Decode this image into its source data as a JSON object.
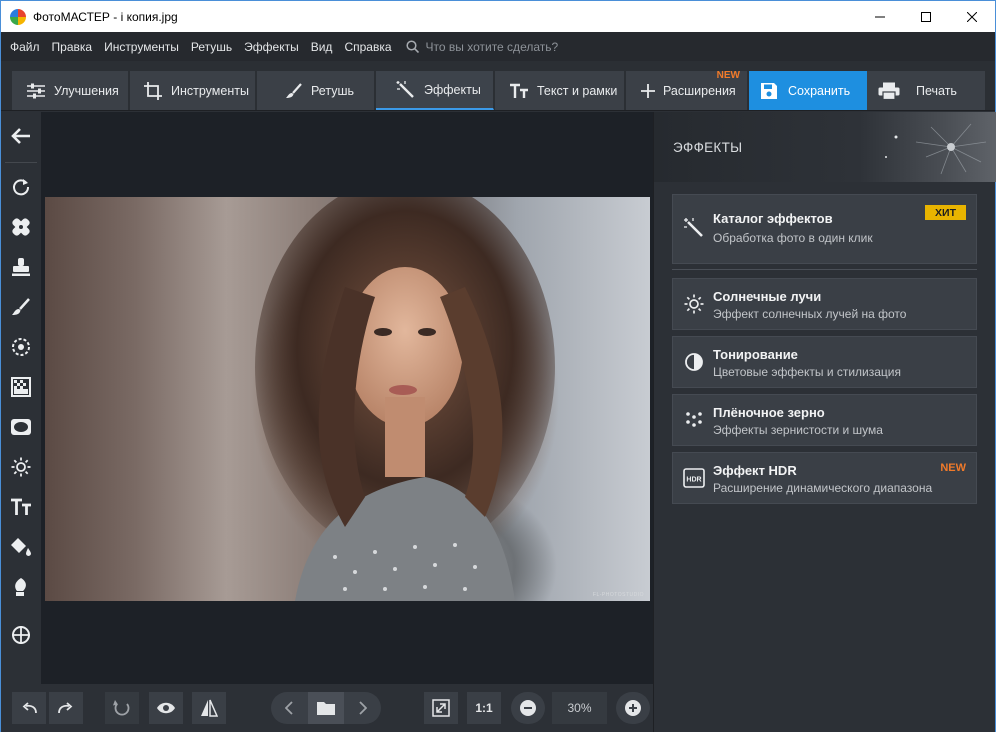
{
  "window": {
    "title": "ФотоМАСТЕР - i копия.jpg",
    "controls": [
      "minimize-icon",
      "maximize-icon",
      "close-icon"
    ]
  },
  "menu": {
    "items": [
      "Файл",
      "Правка",
      "Инструменты",
      "Ретушь",
      "Эффекты",
      "Вид",
      "Справка"
    ],
    "search_placeholder": "Что вы хотите сделать?"
  },
  "toolbar": {
    "tabs": [
      {
        "label": "Улучшения",
        "icon": "sliders-icon"
      },
      {
        "label": "Инструменты",
        "icon": "crop-icon"
      },
      {
        "label": "Ретушь",
        "icon": "brush-icon"
      },
      {
        "label": "Эффекты",
        "icon": "magic-wand-icon",
        "active": true
      },
      {
        "label": "Текст и рамки",
        "icon": "text-icon"
      },
      {
        "label": "Расширения",
        "icon": "plus-icon",
        "badge": "NEW"
      }
    ],
    "save_label": "Сохранить",
    "print_label": "Печать"
  },
  "left_tools": [
    "back-arrow-icon",
    "rotate-icon",
    "patch-icon",
    "stamp-icon",
    "brush-icon",
    "radial-icon",
    "gradient-icon",
    "vignette-icon",
    "sun-icon",
    "text-icon",
    "fill-icon",
    "pen-icon",
    "target-icon"
  ],
  "photo": {
    "watermark": "FL-PHOTOSTUDIO"
  },
  "bottom": {
    "zoom_ratio": "1:1",
    "zoom_value": "30%"
  },
  "panel": {
    "title": "ЭФФЕКТЫ",
    "cards": [
      {
        "title": "Каталог эффектов",
        "subtitle": "Обработка фото в один клик",
        "icon": "magic-wand-icon",
        "badge": "ХИТ"
      },
      {
        "title": "Солнечные лучи",
        "subtitle": "Эффект солнечных лучей на фото",
        "icon": "sun-icon"
      },
      {
        "title": "Тонирование",
        "subtitle": "Цветовые эффекты и стилизация",
        "icon": "toning-icon"
      },
      {
        "title": "Плёночное зерно",
        "subtitle": "Эффекты зернистости и шума",
        "icon": "grain-icon"
      },
      {
        "title": "Эффект HDR",
        "subtitle": "Расширение динамического диапазона",
        "icon": "hdr-icon",
        "badge": "NEW"
      }
    ]
  },
  "colors": {
    "accent": "#1e8fe0",
    "active_tab_border": "#3b9ae8",
    "hit_badge": "#e8b400",
    "new_badge": "#f07a2a"
  }
}
